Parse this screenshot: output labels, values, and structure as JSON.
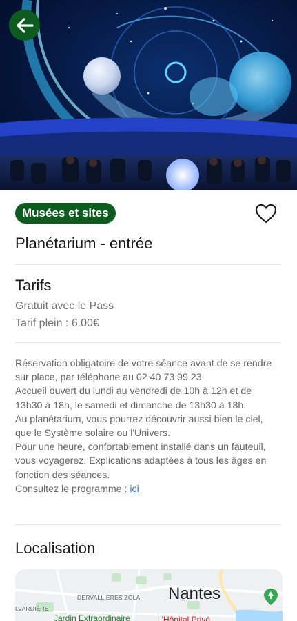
{
  "hero": {
    "back_icon": "arrow-left-icon",
    "image_subject": "planetarium-dome"
  },
  "header": {
    "category": "Musées et sites",
    "favorite_icon": "heart-outline-icon",
    "title": "Planétarium - entrée"
  },
  "tarifs": {
    "title": "Tarifs",
    "lines": [
      "Gratuit avec le Pass",
      "Tarif plein : 6.00€"
    ]
  },
  "description": {
    "paragraphs": [
      "Réservation obligatoire de votre séance avant de se rendre sur place, par téléphone au 02 40 73 99 23.",
      "Accueil ouvert du lundi au vendredi de 10h à 12h et de 13h30 à 18h, le samedi et dimanche de 13h30 à 18h.",
      "Au planétarium, vous pourrez découvrir aussi bien le ciel, que le Système solaire ou l'Univers.",
      "Pour une heure, confortablement installé dans un fauteuil, vous voyagerez. Explications adaptées à tous les âges en fonction des séances."
    ],
    "program_prefix": "Consultez le programme : ",
    "program_link": "ici"
  },
  "localisation": {
    "title": "Localisation",
    "map": {
      "city": "Nantes",
      "label_dervallieres": "DERVALLIÈRES ZOLA",
      "label_lvardiere": "LVARDIÈRE",
      "label_jardin": "Jardin Extraordinaire",
      "label_hopital": "L'Hôpital Privé",
      "pin_icon": "map-pin-icon"
    }
  },
  "colors": {
    "brand_green": "#0d5b1f",
    "link_blue": "#3a6fd8"
  }
}
